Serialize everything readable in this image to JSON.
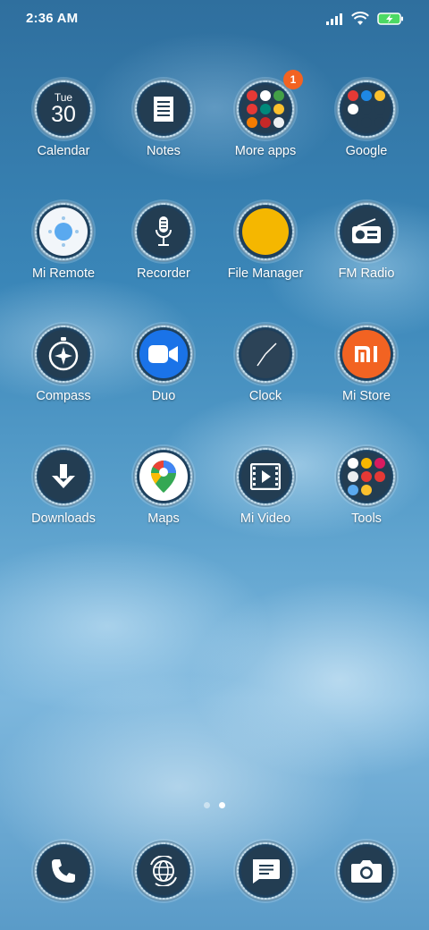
{
  "status_bar": {
    "time": "2:36 AM",
    "icons": [
      "signal-icon",
      "wifi-icon",
      "battery-charging-icon"
    ],
    "battery_color": "#4cd964"
  },
  "calendar": {
    "weekday": "Tue",
    "date": "30"
  },
  "apps": [
    {
      "label": "Calendar",
      "icon": "calendar-icon"
    },
    {
      "label": "Notes",
      "icon": "notes-icon"
    },
    {
      "label": "More apps",
      "icon": "folder-icon",
      "badge": "1"
    },
    {
      "label": "Google",
      "icon": "folder-icon"
    },
    {
      "label": "Mi Remote",
      "icon": "remote-icon"
    },
    {
      "label": "Recorder",
      "icon": "microphone-icon"
    },
    {
      "label": "File Manager",
      "icon": "file-manager-icon"
    },
    {
      "label": "FM Radio",
      "icon": "radio-icon"
    },
    {
      "label": "Compass",
      "icon": "compass-icon"
    },
    {
      "label": "Duo",
      "icon": "video-camera-icon"
    },
    {
      "label": "Clock",
      "icon": "clock-icon"
    },
    {
      "label": "Mi Store",
      "icon": "mi-store-icon"
    },
    {
      "label": "Downloads",
      "icon": "download-icon"
    },
    {
      "label": "Maps",
      "icon": "maps-pin-icon"
    },
    {
      "label": "Mi Video",
      "icon": "video-play-icon"
    },
    {
      "label": "Tools",
      "icon": "folder-icon"
    }
  ],
  "dock": [
    {
      "name": "phone",
      "icon": "phone-icon"
    },
    {
      "name": "browser",
      "icon": "globe-icon"
    },
    {
      "name": "messages",
      "icon": "message-icon"
    },
    {
      "name": "camera",
      "icon": "camera-icon"
    }
  ],
  "page_indicator": {
    "pages": 2,
    "current": 2
  },
  "colors": {
    "badge": "#f26322",
    "mi_store": "#f26322",
    "file_manager": "#f5b700",
    "mi_remote": "#5aa9ef",
    "duo": "#1a73e8"
  }
}
